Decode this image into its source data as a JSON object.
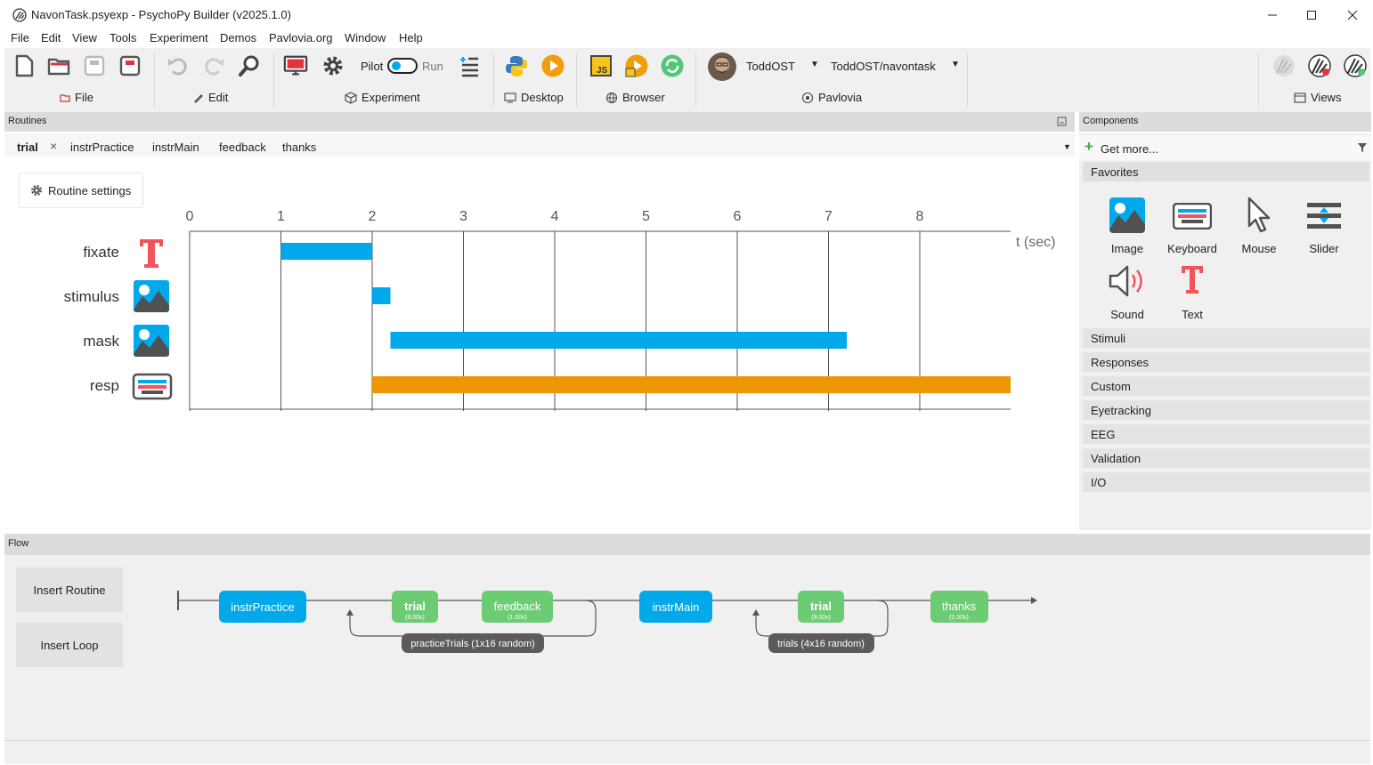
{
  "window": {
    "title": "NavonTask.psyexp - PsychoPy Builder (v2025.1.0)"
  },
  "menu": [
    "File",
    "Edit",
    "View",
    "Tools",
    "Experiment",
    "Demos",
    "Pavlovia.org",
    "Window",
    "Help"
  ],
  "toolbar": {
    "groups": {
      "file": "File",
      "edit": "Edit",
      "experiment": "Experiment",
      "desktop": "Desktop",
      "browser": "Browser",
      "pavlovia": "Pavlovia",
      "views": "Views"
    },
    "pilot_label": "Pilot",
    "run_label": "Run",
    "user": "ToddOST",
    "project": "ToddOST/navontask"
  },
  "colors": {
    "accent": "#02a9ea",
    "keyboard_bar": "#ec9703",
    "routine_box": "#02a9ea",
    "loop_routine_box": "#6ccc74",
    "loop_label": "#5b5b5b",
    "text_icon": "#f2545b"
  },
  "routines": {
    "header": "Routines",
    "tabs": [
      "trial",
      "instrPractice",
      "instrMain",
      "feedback",
      "thanks"
    ],
    "active_tab": "trial",
    "settings_button": "Routine settings",
    "timeline": {
      "axis_label": "t (sec)",
      "ticks": [
        "0",
        "1",
        "2",
        "3",
        "4",
        "5",
        "6",
        "7",
        "8"
      ],
      "components": [
        {
          "name": "fixate",
          "icon": "text-icon",
          "start": 1,
          "stop": 2,
          "color": "#02a9ea"
        },
        {
          "name": "stimulus",
          "icon": "image-icon",
          "start": 2,
          "stop": 2.2,
          "color": "#02a9ea"
        },
        {
          "name": "mask",
          "icon": "image-icon",
          "start": 2.2,
          "stop": 7.2,
          "color": "#02a9ea"
        },
        {
          "name": "resp",
          "icon": "keyboard-icon",
          "start": 2,
          "stop": 9,
          "color": "#ec9703"
        }
      ]
    }
  },
  "components": {
    "header": "Components",
    "get_more": "Get more...",
    "favorites_label": "Favorites",
    "favorites": [
      "Image",
      "Keyboard",
      "Mouse",
      "Slider",
      "Sound",
      "Text"
    ],
    "categories": [
      "Stimuli",
      "Responses",
      "Custom",
      "Eyetracking",
      "EEG",
      "Validation",
      "I/O"
    ]
  },
  "flow": {
    "header": "Flow",
    "insert_routine": "Insert Routine",
    "insert_loop": "Insert Loop",
    "items": {
      "instrPractice": "instrPractice",
      "trial1": {
        "name": "trial",
        "dur": "(9.00s)"
      },
      "feedback": {
        "name": "feedback",
        "dur": "(1.00s)"
      },
      "instrMain": "instrMain",
      "trial2": {
        "name": "trial",
        "dur": "(9.00s)"
      },
      "thanks": {
        "name": "thanks",
        "dur": "(2.00s)"
      }
    },
    "loops": [
      "practiceTrials (1x16 random)",
      "trials (4x16 random)"
    ]
  }
}
